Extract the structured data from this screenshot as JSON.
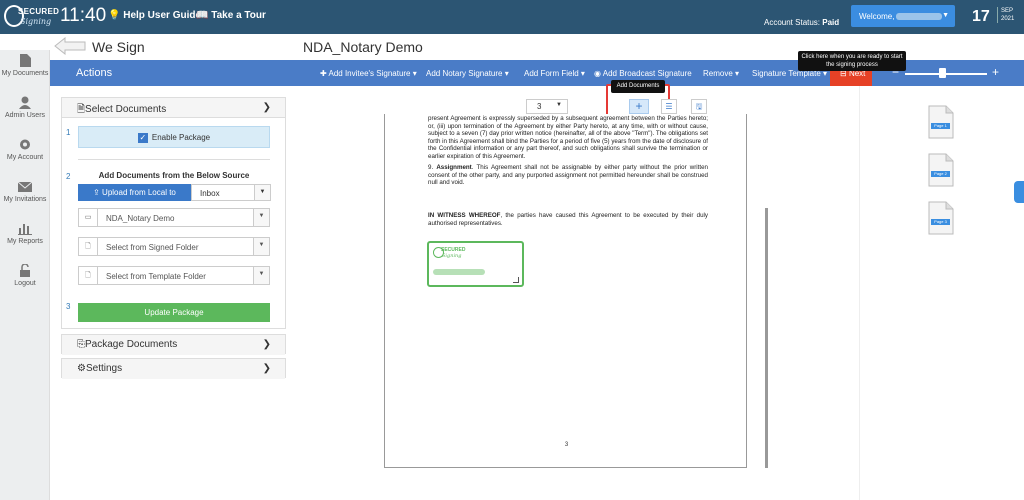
{
  "topbar": {
    "time": "11:40",
    "help": "Help User Guide",
    "tour": "Take a Tour",
    "account_label": "Account Status:",
    "account_value": "Paid",
    "welcome": "Welcome,",
    "day": "17",
    "month": "SEP",
    "year": "2021",
    "logo_top": "SECURED",
    "logo_bottom": "Signing"
  },
  "sidebar": {
    "items": [
      {
        "label": "My Documents",
        "icon": "document-icon"
      },
      {
        "label": "Admin Users",
        "icon": "user-icon"
      },
      {
        "label": "My Account",
        "icon": "gear-icon"
      },
      {
        "label": "My Invitations",
        "icon": "envelope-icon"
      },
      {
        "label": "My Reports",
        "icon": "chart-icon"
      },
      {
        "label": "Logout",
        "icon": "lock-icon"
      }
    ]
  },
  "header": {
    "app": "We Sign",
    "doc_title": "NDA_Notary Demo"
  },
  "actionbar": {
    "title": "Actions",
    "menus": [
      "Add Invitee's Signature",
      "Add Notary Signature",
      "Add Form Field",
      "Add Broadcast Signature",
      "Remove",
      "Signature Template"
    ],
    "next": "Next",
    "zoom_minus": "−",
    "zoom_plus": "+"
  },
  "tooltips": {
    "next": "Click here when you are ready to start the signing process",
    "add": "Add Documents"
  },
  "panel": {
    "select_title": "Select Documents",
    "enable_package": "Enable Package",
    "add_source_title": "Add Documents from the Below Source",
    "upload_btn": "Upload from Local to",
    "inbox": "Inbox",
    "doc_select": "NDA_Notary Demo",
    "signed_folder": "Select from Signed Folder",
    "template_folder": "Select from Template Folder",
    "update_btn": "Update Package",
    "step1": "1",
    "step2": "2",
    "step3": "3",
    "package_docs": "Package Documents",
    "settings": "Settings"
  },
  "viewer": {
    "page_value": "3",
    "page_number": "3",
    "para1": "present Agreement is expressly superseded by a subsequent agreement between the Parties hereto; or, (iii) upon termination of the Agreement by either Party hereto, at any time, with or without cause, subject to a seven (7) day prior written notice (hereinafter, all of the above \"Term\"). The obligations set forth in this Agreement shall bind the Parties for a period of five (5) years from the date of disclosure of the Confidential information or any part thereof, and such obligations shall survive the termination or earlier expiration of this Agreement.",
    "item9_num": "9.",
    "item9_title": "Assignment",
    "item9_text": ". This Agreement shall not be assignable by either party without the prior written consent of the other party, and any purported assignment not permitted hereunder shall be construed null and void.",
    "witness_bold": "IN WITNESS WHEREOF",
    "witness_text": ", the parties have caused this Agreement to be executed by their duly authorised representatives."
  },
  "thumbs": [
    "Page 1",
    "Page 2",
    "Page 3"
  ]
}
